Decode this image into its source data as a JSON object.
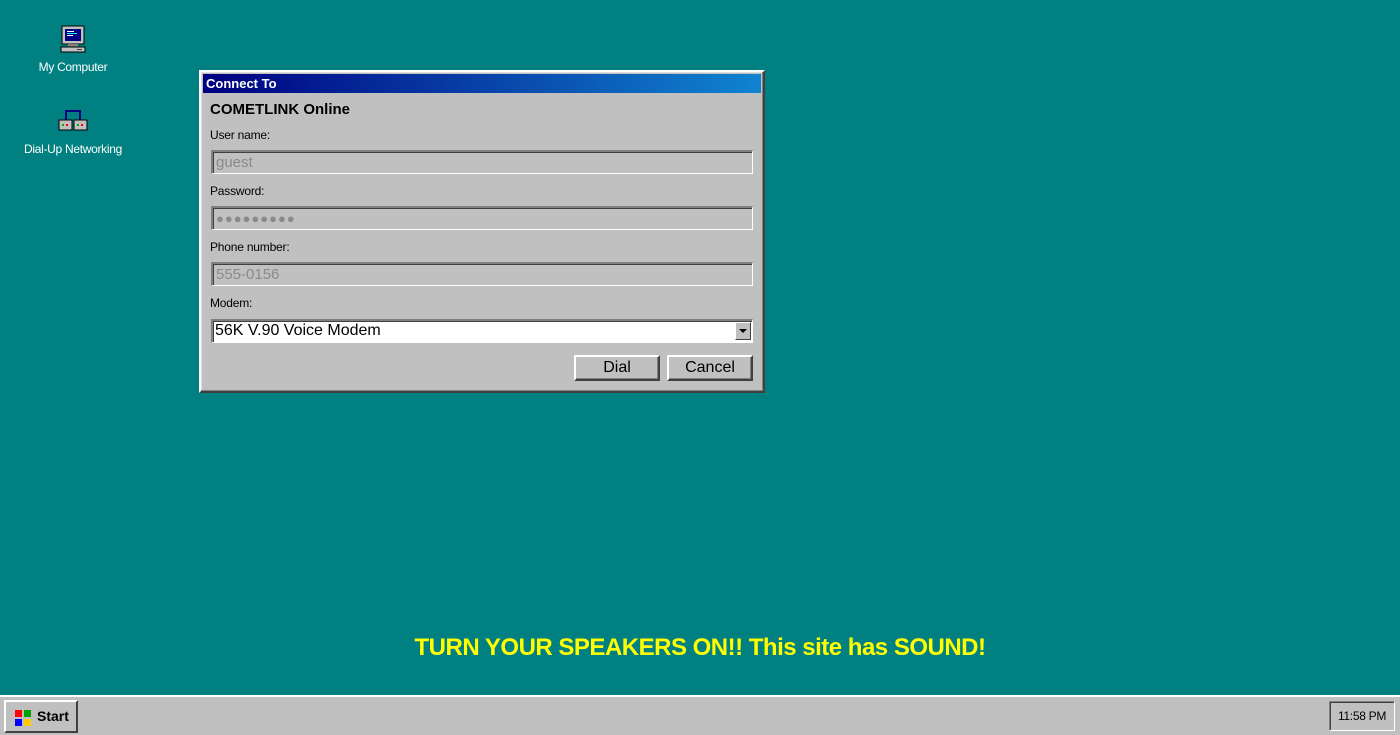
{
  "desktop": {
    "icons": [
      {
        "label": "My Computer",
        "icon": "computer-icon"
      },
      {
        "label": "Dial-Up Networking",
        "icon": "network-icon"
      }
    ],
    "banner": "TURN YOUR SPEAKERS ON!! This site has SOUND!"
  },
  "dialog": {
    "title": "Connect To",
    "connection_name": "COMETLINK Online",
    "username_label": "User name:",
    "username_value": "guest",
    "password_label": "Password:",
    "password_value": "●●●●●●●●●",
    "phone_label": "Phone number:",
    "phone_value": "555-0156",
    "modem_label": "Modem:",
    "modem_value": "56K V.90 Voice Modem",
    "dial_label": "Dial",
    "cancel_label": "Cancel"
  },
  "taskbar": {
    "start_label": "Start",
    "clock": "11:58 PM"
  },
  "colors": {
    "desktop": "#008080",
    "banner_text": "#ffff00",
    "titlebar_start": "#000080",
    "titlebar_end": "#1084d0",
    "chrome": "#c0c0c0"
  }
}
